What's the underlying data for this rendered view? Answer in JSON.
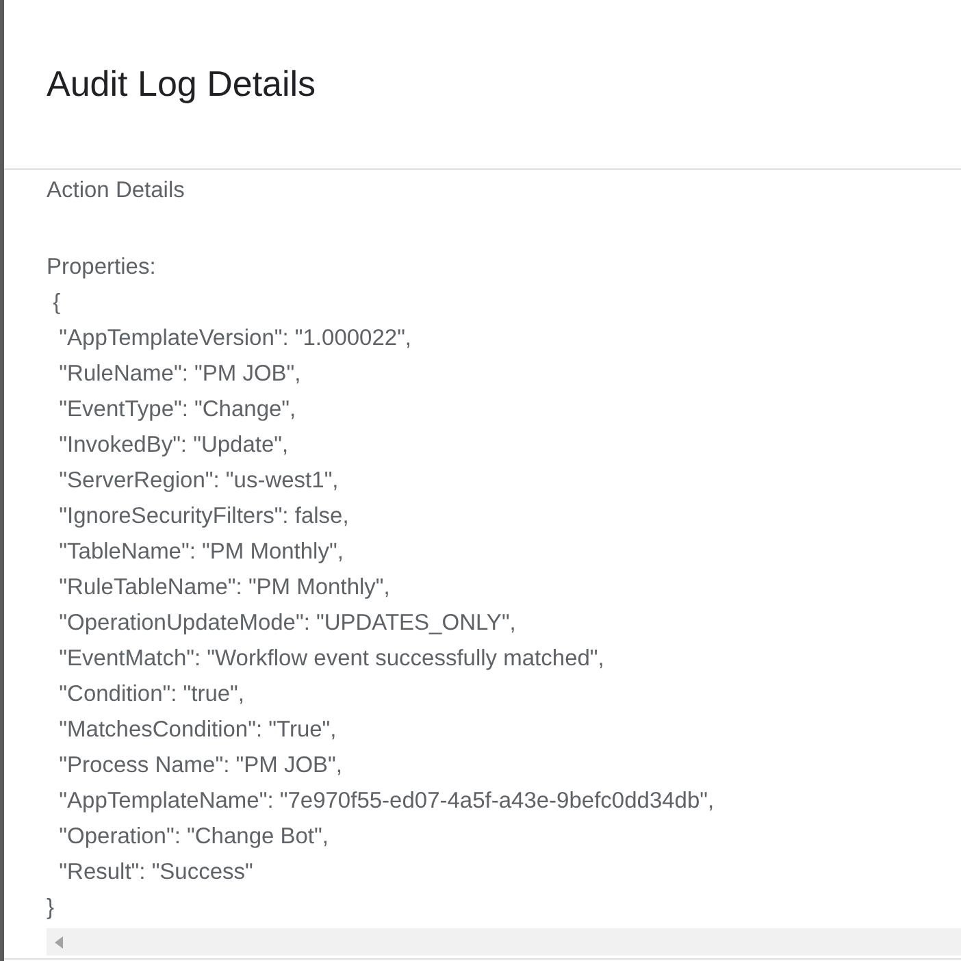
{
  "dialog": {
    "title": "Audit Log Details",
    "section_label": "Action Details",
    "properties_label": "Properties:",
    "property_lines": [
      " {",
      "  \"AppTemplateVersion\": \"1.000022\",",
      "  \"RuleName\": \"PM JOB\",",
      "  \"EventType\": \"Change\",",
      "  \"InvokedBy\": \"Update\",",
      "  \"ServerRegion\": \"us-west1\",",
      "  \"IgnoreSecurityFilters\": false,",
      "  \"TableName\": \"PM Monthly\",",
      "  \"RuleTableName\": \"PM Monthly\",",
      "  \"OperationUpdateMode\": \"UPDATES_ONLY\",",
      "  \"EventMatch\": \"Workflow event successfully matched\",",
      "  \"Condition\": \"true\",",
      "  \"MatchesCondition\": \"True\",",
      "  \"Process Name\": \"PM JOB\",",
      "  \"AppTemplateName\": \"7e970f55-ed07-4a5f-a43e-9befc0dd34db\",",
      "  \"Operation\": \"Change Bot\",",
      "  \"Result\": \"Success\"",
      "}"
    ]
  }
}
